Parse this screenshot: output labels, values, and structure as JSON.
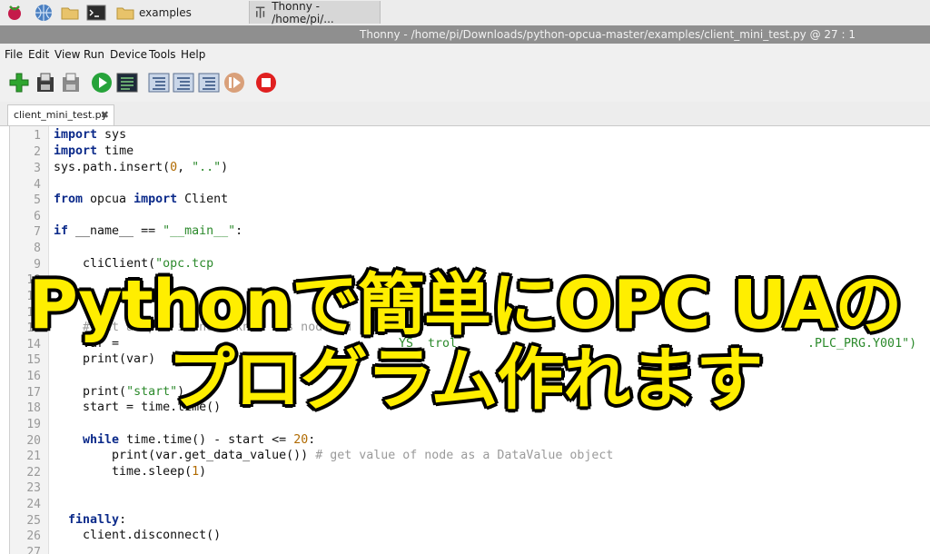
{
  "taskbar": {
    "folder_label": "examples",
    "thonny_label": "Thonny  -  /home/pi/..."
  },
  "window": {
    "title": "Thonny  -  /home/pi/Downloads/python-opcua-master/examples/client_mini_test.py  @  27 : 1"
  },
  "menu": [
    "File",
    "Edit",
    "View",
    "Run",
    "Device",
    "Tools",
    "Help"
  ],
  "tab": {
    "label": "client_mini_test.py",
    "close": "✖"
  },
  "code": {
    "line_numbers": [
      "1",
      "2",
      "3",
      "4",
      "5",
      "6",
      "7",
      "8",
      "9",
      "10",
      "11",
      "12",
      "13",
      "14",
      "15",
      "16",
      "17",
      "18",
      "19",
      "20",
      "21",
      "22",
      "23",
      "24",
      "25",
      "26",
      "27"
    ],
    "l1_kw": "import",
    "l1_rest": " sys",
    "l2_kw": "import",
    "l2_rest": " time",
    "l3_a": "sys.path.insert(",
    "l3_num": "0",
    "l3_b": ", ",
    "l3_str": "\"..\"",
    "l3_c": ")",
    "l5_kw1": "from",
    "l5_mid": " opcua ",
    "l5_kw2": "import",
    "l5_rest": " Client",
    "l7_kw": "if",
    "l7_mid": " __name__ == ",
    "l7_str": "\"__main__\"",
    "l7_end": ":",
    "l9_a": "    cli",
    "l9_b": "Client(",
    "l9_str": "\"opc.tcp",
    "l12_a": "    ",
    "l13_cmt": "    # get a spe  ic node kno    s node id",
    "l14_a": "    var = ",
    "l14_b": "YS  trol",
    "l14_c": ".PLC_PRG.Y001\")",
    "l15": "    print(var)",
    "l17_a": "    print(",
    "l17_str": "\"start\"",
    "l17_b": ")",
    "l18": "    start = time.time()",
    "l20_kw": "    while",
    "l20_mid": " time.time() - start <= ",
    "l20_num": "20",
    "l20_end": ":",
    "l21_a": "        print(var.get_data_value()) ",
    "l21_cmt": "# get value of node as a DataValue object",
    "l22_a": "        time.sleep(",
    "l22_num": "1",
    "l22_b": ")",
    "l25_kw": "  finally",
    "l25_end": ":",
    "l26": "    client.disconnect()"
  },
  "overlay": {
    "line1": "PythonでC簡単にOPC UAの",
    "line1_fixed": "Pythonで簡単にOPC UAの",
    "line2": "プログラム作れます"
  },
  "colors": {
    "overlay_fill": "#ffee00",
    "overlay_stroke": "#000000",
    "keyword": "#0b2a8a",
    "string": "#2c8a2c",
    "number": "#b06a00",
    "comment": "#9a9a9a"
  }
}
